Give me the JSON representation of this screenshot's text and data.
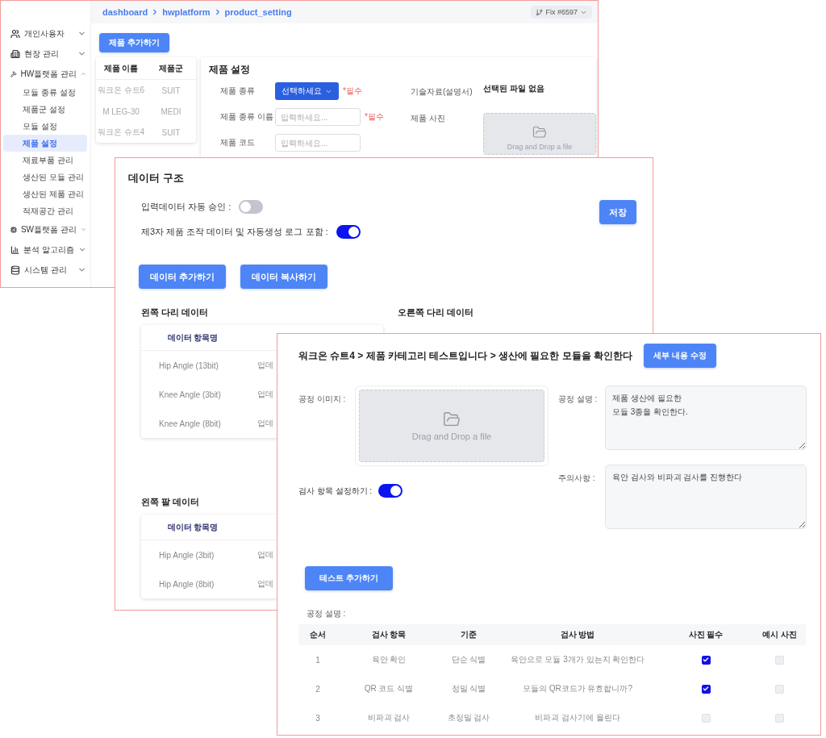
{
  "product_window": {
    "sidebar": {
      "items": [
        {
          "label": "개인사용자",
          "selected": false,
          "expanded": false
        },
        {
          "label": "현장 관리",
          "selected": false,
          "expanded": false
        },
        {
          "label": "HW플랫폼 관리",
          "selected": false,
          "expanded": true,
          "children": [
            {
              "label": "모듈 종류 설정",
              "selected": false
            },
            {
              "label": "제품군 설정",
              "selected": false
            },
            {
              "label": "모듈 설정",
              "selected": false
            },
            {
              "label": "제품 설정",
              "selected": true
            },
            {
              "label": "재료부품 관리",
              "selected": false
            },
            {
              "label": "생산된 모듈 관리",
              "selected": false
            },
            {
              "label": "생산된 제품 관리",
              "selected": false
            },
            {
              "label": "적재공간 관리",
              "selected": false
            }
          ]
        },
        {
          "label": "SW플랫폼 관리",
          "selected": false,
          "expanded": false
        },
        {
          "label": "분석 알고리즘",
          "selected": false,
          "expanded": false
        },
        {
          "label": "시스템 관리",
          "selected": false,
          "expanded": false
        }
      ]
    },
    "breadcrumb": [
      "dashboard",
      "hwplatform",
      "product_setting"
    ],
    "branch_badge": "Fix #6597",
    "add_button": "제품 추가하기",
    "product_table": {
      "columns": [
        "제품 이름",
        "제품군"
      ],
      "rows": [
        [
          "워크온 슈트6",
          "SUIT"
        ],
        [
          "M LEG-30",
          "MEDI"
        ],
        [
          "워크온 슈트4",
          "SUIT"
        ]
      ]
    },
    "settings": {
      "title": "제품 설정",
      "fields": [
        {
          "kind": "select",
          "label": "제품 종류",
          "value": "선택하세요",
          "required": "*필수"
        },
        {
          "kind": "input",
          "label": "제품 종류 이름",
          "placeholder": "입력하세요...",
          "required": "*필수"
        },
        {
          "kind": "input",
          "label": "제품 코드",
          "placeholder": "입력하세요..."
        }
      ],
      "attachment": {
        "label": "기술자료(설명서)",
        "value": "선택된 파일 없음"
      },
      "photo": {
        "label": "제품 사진",
        "dropzone": "Drag and Drop a file"
      }
    }
  },
  "data_structure_window": {
    "title": "데이터 구조",
    "toggles": [
      {
        "label": "입력데이터 자동 승인 :",
        "on": false
      },
      {
        "label": "제3자 제품 조작 데이터 및 자동생성 로그 포함 :",
        "on": true
      }
    ],
    "save_button": "저장",
    "buttons": [
      "데이터 추가하기",
      "데이터 복사하기"
    ],
    "sections": [
      {
        "title": "왼쪽 다리 데이터",
        "columns": [
          "데이터 항목명"
        ],
        "rows": [
          [
            "Hip Angle (13bit)",
            "업데"
          ],
          [
            "Knee Angle (3bit)",
            "업데"
          ],
          [
            "Knee Angle (8bit)",
            "업데"
          ]
        ]
      },
      {
        "title": "오른쪽 다리 데이터"
      },
      {
        "title": "왼쪽 팔 데이터",
        "columns": [
          "데이터 항목명"
        ],
        "rows": [
          [
            "Hip Angle (3bit)",
            "업데"
          ],
          [
            "Hip Angle (8bit)",
            "업데"
          ]
        ]
      }
    ]
  },
  "process_window": {
    "title": "워크온 슈트4 > 제품 카테고리 테스트입니다 > 생산에 필요한 모듈을 확인한다",
    "edit_button": "세부 내용 수정",
    "image": {
      "label": "공정 이미지 :",
      "dropzone": "Drag and Drop a file"
    },
    "description": {
      "label": "공정 설명 :",
      "value": "제품 생산에 필요한\n모듈 3종을 확인한다."
    },
    "caution": {
      "label": "주의사항 :",
      "value": "육안 검사와 비파괴 검사를 진행한다"
    },
    "inspection_toggle": {
      "label": "검사 항목 설정하기 :",
      "on": true
    },
    "add_test_button": "테스트 추가하기",
    "table_label": "공정 설명 :",
    "table": {
      "columns": [
        "순서",
        "검사 항목",
        "기준",
        "검사 방법",
        "사진 필수",
        "예시 사진"
      ],
      "rows": [
        {
          "cells": [
            "1",
            "육안 확인",
            "단순 식별",
            "육안으로 모듈 3개가 있는지 확인한다"
          ],
          "photo_required": true,
          "example_photo": false
        },
        {
          "cells": [
            "2",
            "QR 코드 식별",
            "정밀 식별",
            "모듈의 QR코드가 유효합니까?"
          ],
          "photo_required": true,
          "example_photo": false
        },
        {
          "cells": [
            "3",
            "비파괴 검사",
            "초정밀 검사",
            "비파괴 검사기에 올린다"
          ],
          "photo_required": false,
          "example_photo": false
        }
      ]
    }
  }
}
